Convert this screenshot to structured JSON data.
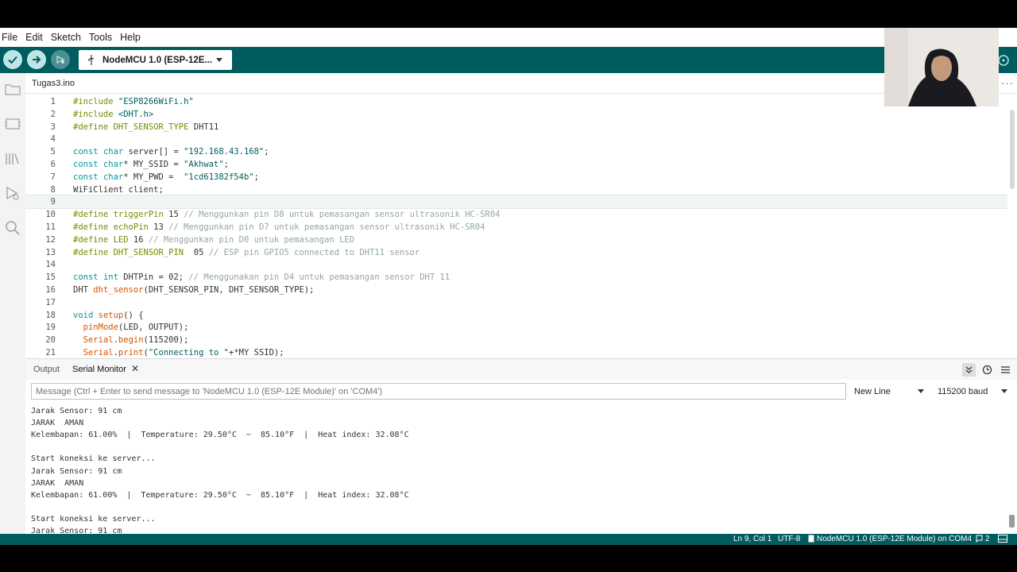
{
  "menu": [
    "File",
    "Edit",
    "Sketch",
    "Tools",
    "Help"
  ],
  "toolbar": {
    "verify_icon": "check-icon",
    "upload_icon": "arrow-right-icon",
    "debug_icon": "debug-icon",
    "board": "NodeMCU 1.0 (ESP-12E..."
  },
  "sidebar": [
    "folder-icon",
    "board-icon",
    "library-icon",
    "debug-icon",
    "search-icon"
  ],
  "tabs": {
    "file": "Tugas3.ino",
    "more": "···"
  },
  "code": [
    {
      "n": "1",
      "parts": [
        [
          "pp",
          "#include"
        ],
        [
          "",
          " "
        ],
        [
          "str",
          "\"ESP8266WiFi.h\""
        ]
      ]
    },
    {
      "n": "2",
      "parts": [
        [
          "pp",
          "#include"
        ],
        [
          "",
          " "
        ],
        [
          "str",
          "<DHT.h>"
        ]
      ]
    },
    {
      "n": "3",
      "parts": [
        [
          "pp",
          "#define"
        ],
        [
          "",
          " "
        ],
        [
          "pp",
          "DHT_SENSOR_TYPE"
        ],
        [
          "",
          " DHT11"
        ]
      ]
    },
    {
      "n": "4",
      "parts": []
    },
    {
      "n": "5",
      "parts": [
        [
          "kw",
          "const"
        ],
        [
          "",
          " "
        ],
        [
          "kw",
          "char"
        ],
        [
          "",
          " server[] = "
        ],
        [
          "str",
          "\"192.168.43.168\""
        ],
        [
          "",
          ";"
        ]
      ]
    },
    {
      "n": "6",
      "parts": [
        [
          "kw",
          "const"
        ],
        [
          "",
          " "
        ],
        [
          "kw",
          "char"
        ],
        [
          "",
          "* MY_SSID = "
        ],
        [
          "str",
          "\"Akhwat\""
        ],
        [
          "",
          ";"
        ]
      ]
    },
    {
      "n": "7",
      "parts": [
        [
          "kw",
          "const"
        ],
        [
          "",
          " "
        ],
        [
          "kw",
          "char"
        ],
        [
          "",
          "* MY_PWD =  "
        ],
        [
          "str",
          "\"1cd61382f54b\""
        ],
        [
          "",
          ";"
        ]
      ]
    },
    {
      "n": "8",
      "parts": [
        [
          "",
          "WiFiClient client;"
        ]
      ]
    },
    {
      "n": "9",
      "parts": [],
      "current": true
    },
    {
      "n": "10",
      "parts": [
        [
          "pp",
          "#define"
        ],
        [
          "",
          " "
        ],
        [
          "pp",
          "triggerPin"
        ],
        [
          "",
          " 15 "
        ],
        [
          "cmt",
          "// Menggunkan pin D8 untuk pemasangan sensor ultrasonik HC-SR04"
        ]
      ]
    },
    {
      "n": "11",
      "parts": [
        [
          "pp",
          "#define"
        ],
        [
          "",
          " "
        ],
        [
          "pp",
          "echoPin"
        ],
        [
          "",
          " 13 "
        ],
        [
          "cmt",
          "// Menggunkan pin D7 untuk pemasangan sensor ultrasonik HC-SR04"
        ]
      ]
    },
    {
      "n": "12",
      "parts": [
        [
          "pp",
          "#define"
        ],
        [
          "",
          " "
        ],
        [
          "pp",
          "LED"
        ],
        [
          "",
          " 16 "
        ],
        [
          "cmt",
          "// Menggunkan pin D0 untuk pemasangan LED"
        ]
      ]
    },
    {
      "n": "13",
      "parts": [
        [
          "pp",
          "#define"
        ],
        [
          "",
          " "
        ],
        [
          "pp",
          "DHT_SENSOR_PIN"
        ],
        [
          "",
          "  05 "
        ],
        [
          "cmt",
          "// ESP pin GPIO5 connected to DHT11 sensor"
        ]
      ]
    },
    {
      "n": "14",
      "parts": []
    },
    {
      "n": "15",
      "parts": [
        [
          "kw",
          "const"
        ],
        [
          "",
          " "
        ],
        [
          "kw",
          "int"
        ],
        [
          "",
          " DHTPin = 02; "
        ],
        [
          "cmt",
          "// Menggunakan pin D4 untuk pemasangan sensor DHT 11"
        ]
      ]
    },
    {
      "n": "16",
      "parts": [
        [
          "",
          "DHT "
        ],
        [
          "fn",
          "dht_sensor"
        ],
        [
          "",
          "(DHT_SENSOR_PIN, DHT_SENSOR_TYPE);"
        ]
      ]
    },
    {
      "n": "17",
      "parts": []
    },
    {
      "n": "18",
      "parts": [
        [
          "kw",
          "void"
        ],
        [
          "",
          " "
        ],
        [
          "fn",
          "setup"
        ],
        [
          "",
          "() {"
        ]
      ]
    },
    {
      "n": "19",
      "parts": [
        [
          "",
          "  "
        ],
        [
          "fn",
          "pinMode"
        ],
        [
          "",
          "(LED, OUTPUT);"
        ]
      ]
    },
    {
      "n": "20",
      "parts": [
        [
          "",
          "  "
        ],
        [
          "fn",
          "Serial"
        ],
        [
          "",
          "."
        ],
        [
          "fn",
          "begin"
        ],
        [
          "",
          "(115200);"
        ]
      ]
    },
    {
      "n": "21",
      "parts": [
        [
          "",
          "  "
        ],
        [
          "fn",
          "Serial"
        ],
        [
          "",
          "."
        ],
        [
          "fn",
          "print"
        ],
        [
          "",
          "("
        ],
        [
          "str",
          "\"Connecting to \""
        ],
        [
          "",
          "+*MY SSID);"
        ]
      ]
    }
  ],
  "panel": {
    "tab_output": "Output",
    "tab_serial": "Serial Monitor",
    "close": "✕",
    "icons": [
      "double-chevron-down-icon",
      "clock-icon",
      "menu-lines-icon"
    ],
    "message_placeholder": "Message (Ctrl + Enter to send message to 'NodeMCU 1.0 (ESP-12E Module)' on 'COM4')",
    "line_ending": "New Line",
    "baud": "115200 baud"
  },
  "serial_output": [
    "Jarak Sensor: 91 cm",
    "JARAK  AMAN",
    "Kelembapan: 61.00%  |  Temperature: 29.50°C  ~  85.10°F  |  Heat index: 32.08°C",
    "",
    "Start koneksi ke server...",
    "Jarak Sensor: 91 cm",
    "JARAK  AMAN",
    "Kelembapan: 61.00%  |  Temperature: 29.50°C  ~  85.10°F  |  Heat index: 32.08°C",
    "",
    "Start koneksi ke server...",
    "Jarak Sensor: 91 cm"
  ],
  "status": {
    "position": "Ln 9, Col 1",
    "encoding": "UTF-8",
    "board": "NodeMCU 1.0 (ESP-12E Module) on COM4",
    "notifications": "2"
  },
  "colors": {
    "toolbar": "#005c5f",
    "accent": "#00979c",
    "statusbar": "#005c5f"
  }
}
